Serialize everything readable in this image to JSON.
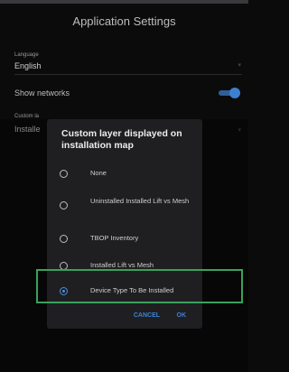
{
  "header": {
    "title": "Application Settings"
  },
  "language": {
    "label": "Language",
    "value": "English"
  },
  "show_networks": {
    "label": "Show networks",
    "enabled": true
  },
  "custom_layer": {
    "label_partial": "Custom la",
    "value_partial": "Installe"
  },
  "dialog": {
    "title": "Custom layer displayed on installation map",
    "options": [
      {
        "label": "None",
        "selected": false
      },
      {
        "label": "Uninstalled Installed Lift vs Mesh",
        "selected": false
      },
      {
        "label": "TBOP Inventory",
        "selected": false
      },
      {
        "label": "Installed Lift vs Mesh",
        "selected": false
      },
      {
        "label": "Device Type To Be Installed",
        "selected": true
      }
    ],
    "cancel_label": "CANCEL",
    "ok_label": "OK"
  },
  "colors": {
    "accent": "#3d82d6",
    "highlight": "#3aa15d"
  }
}
